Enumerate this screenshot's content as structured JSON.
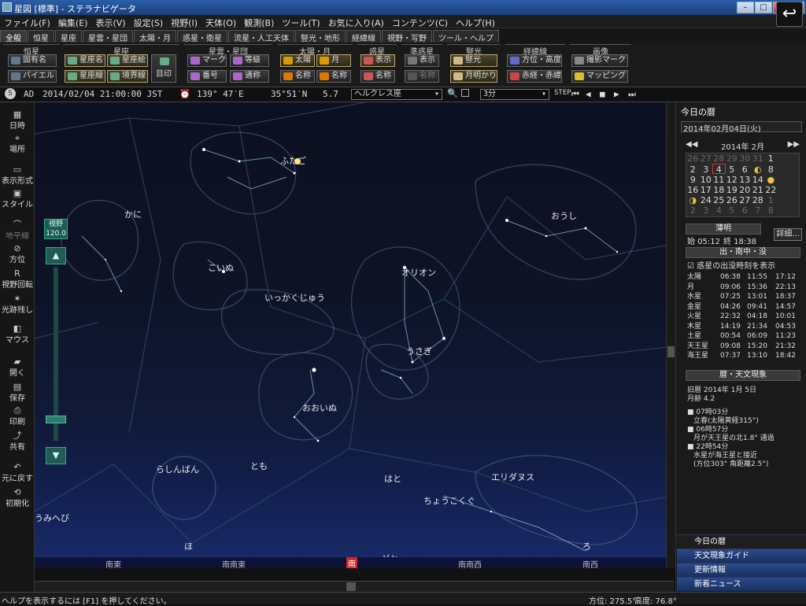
{
  "window": {
    "title": "星図 [標準] - ステラナビゲータ"
  },
  "menu": [
    "ファイル(F)",
    "編集(E)",
    "表示(V)",
    "設定(S)",
    "視野(I)",
    "天体(O)",
    "観測(B)",
    "ツール(T)",
    "お気に入り(A)",
    "コンテンツ(C)",
    "ヘルプ(H)"
  ],
  "tabs": [
    "全般",
    "恒星",
    "星座",
    "星雲・星団",
    "太陽・月",
    "惑星・衛星",
    "流星・人工天体",
    "竪光・地形",
    "経緯線",
    "視野・写野",
    "ツール・ヘルプ"
  ],
  "ribbon": {
    "groups": [
      "恒星",
      "星座",
      "星雲・星団",
      "太陽・月",
      "惑星",
      "準惑星",
      "竪光",
      "経緯線",
      "画像"
    ],
    "buttons": {
      "koyumei": "固有名",
      "bayer": "バイエル",
      "seizamei": "星座名",
      "seizasen": "星座線",
      "seizae": "星座絵",
      "kyokaisen": "境界線",
      "mejirushi": "目印",
      "mark": "マーク",
      "tokyu": "等級",
      "bango": "番号",
      "tsusho": "通称",
      "taiyo": "太陽",
      "tsuki": "月",
      "meisho1": "名称",
      "meisho2": "名称",
      "hyoji": "表示",
      "meisho3": "名称",
      "hyoji2": "表示",
      "meisho4": "名称",
      "keiko": "竪光",
      "gekkoumeikari": "月明かり",
      "hoikodo": "方位・高度",
      "sekkei": "赤経・赤緯",
      "satsuei": "撮影マーク",
      "mapping": "マッピング"
    }
  },
  "timebar": {
    "era": "AD",
    "datetime": "2014/02/04 21:00:00 JST",
    "lon": "139° 47′E",
    "lat": "35°51′N",
    "mag": "5.7",
    "star": "ヘルクレス座",
    "step": "3分"
  },
  "left_toolbar": [
    "日時",
    "場所",
    "表示形式",
    "スタイル",
    "地平線",
    "方位",
    "視野回転",
    "光跡残し",
    "マウス",
    "開く",
    "保存",
    "印刷",
    "共有",
    "元に戻す",
    "初期化"
  ],
  "sky": {
    "constellations": [
      "かに",
      "ふたご",
      "おうし",
      "こいぬ",
      "いっかくじゅう",
      "オリオン",
      "うさぎ",
      "おおいぬ",
      "らしんばん",
      "とも",
      "はと",
      "ちょうこくぐ",
      "エリダヌス",
      "うみへび",
      "ほ",
      "がか",
      "ろ"
    ],
    "fov_label": "視野",
    "fov_value": "120.0",
    "directions": [
      "南東",
      "南南東",
      "南",
      "南南西",
      "南西"
    ]
  },
  "right_panel": {
    "title": "今日の暦",
    "date": "2014年02月04日(火)",
    "month": "2014年 2月",
    "calendar": [
      [
        "26",
        "27",
        "28",
        "29",
        "30",
        "31",
        "1"
      ],
      [
        "2",
        "3",
        "4",
        "5",
        "6",
        "",
        "8"
      ],
      [
        "9",
        "10",
        "11",
        "12",
        "13",
        "14",
        ""
      ],
      [
        "16",
        "17",
        "18",
        "19",
        "20",
        "21",
        "22"
      ],
      [
        "",
        "24",
        "25",
        "26",
        "27",
        "28",
        "1"
      ],
      [
        "2",
        "3",
        "4",
        "5",
        "6",
        "7",
        "8"
      ]
    ],
    "twilight_label": "薄明",
    "twilight_start": "始 05:12",
    "twilight_end": "終 18:38",
    "detail_btn": "詳細...",
    "rise_header": "出・南中・没",
    "rise_checkbox": "惑星の出没時刻を表示",
    "rise_rows": [
      [
        "太陽",
        "06:38",
        "11:55",
        "17:12"
      ],
      [
        "月",
        "09:06",
        "15:36",
        "22:13"
      ],
      [
        "水星",
        "07:25",
        "13:01",
        "18:37"
      ],
      [
        "金星",
        "04:26",
        "09:41",
        "14:57"
      ],
      [
        "火星",
        "22:32",
        "04:18",
        "10:01"
      ],
      [
        "木星",
        "14:19",
        "21:34",
        "04:53"
      ],
      [
        "土星",
        "00:54",
        "06:09",
        "11:23"
      ],
      [
        "天王星",
        "09:08",
        "15:20",
        "21:32"
      ],
      [
        "海王星",
        "07:37",
        "13:10",
        "18:42"
      ]
    ],
    "events_header": "暦・天文現象",
    "events": [
      "旧暦 2014年 1月 5日",
      "月齢 4.2",
      "■ 07時03分",
      "立春(太陽黄経315°)",
      "■ 06時57分",
      "月が天王星の北1.8° 通過",
      "■ 22時54分",
      "水星が海王星と接近",
      "(方位303° 角距離2.5°)"
    ],
    "links": [
      "今日の暦",
      "天文現象ガイド",
      "更新情報",
      "新着ニュース"
    ]
  },
  "status": {
    "help": "ヘルプを表示するには [F1] を押してください。",
    "azimuth": "方位: 275.5°",
    "altitude": "高度: 76.8°"
  },
  "accent": "#2a4a8a"
}
